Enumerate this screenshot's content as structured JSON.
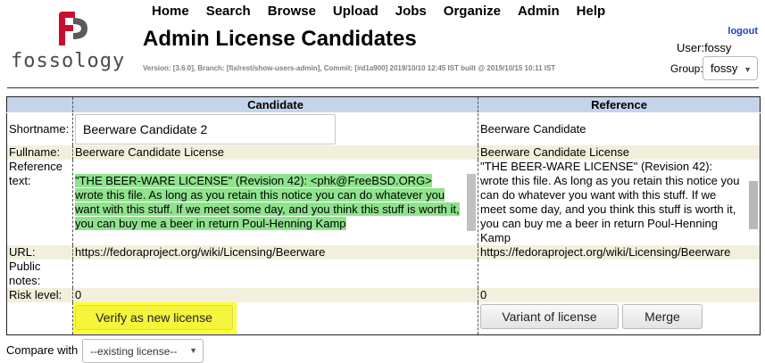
{
  "app": {
    "logo_text": "fossology",
    "brand_color": "#c8102e"
  },
  "nav": {
    "items": [
      {
        "label": "Home"
      },
      {
        "label": "Search"
      },
      {
        "label": "Browse"
      },
      {
        "label": "Upload"
      },
      {
        "label": "Jobs"
      },
      {
        "label": "Organize"
      },
      {
        "label": "Admin"
      },
      {
        "label": "Help"
      }
    ]
  },
  "page": {
    "title": "Admin License Candidates",
    "version": "Version: [3.6.0], Branch: [fix/rest/show-users-admin], Commit: [#d1a900] 2019/10/10 12:45 IST built @ 2019/10/15 10:11 IST"
  },
  "user": {
    "logout_label": "logout",
    "user_label": "User:",
    "user_name": "fossy",
    "group_label": "Group:",
    "group_value": "fossy"
  },
  "table": {
    "headers": {
      "candidate": "Candidate",
      "reference": "Reference"
    },
    "rows": {
      "shortname": {
        "label": "Shortname:",
        "candidate": "Beerware Candidate 2",
        "reference": "Beerware Candidate"
      },
      "fullname": {
        "label": "Fullname:",
        "candidate": "Beerware Candidate License",
        "reference": "Beerware Candidate License"
      },
      "reftext": {
        "label_line1": "Reference",
        "label_line2": "text:",
        "candidate": "\"THE BEER-WARE LICENSE\" (Revision 42): <phk@FreeBSD.ORG> wrote this file. As long as you retain this notice you can do whatever you want with this stuff. If we meet some day, and you think this stuff is worth it, you can buy me a beer in return Poul-Henning Kamp",
        "reference": "\"THE BEER-WARE LICENSE\" (Revision 42): wrote this file. As long as you retain this notice you can do whatever you want with this stuff. If we meet some day, and you think this stuff is worth it, you can buy me a beer in return Poul-Henning Kamp"
      },
      "url": {
        "label": "URL:",
        "candidate": "https://fedoraproject.org/wiki/Licensing/Beerware",
        "reference": "https://fedoraproject.org/wiki/Licensing/Beerware"
      },
      "public_notes": {
        "label_line1": "Public",
        "label_line2": "notes:",
        "candidate": "",
        "reference": ""
      },
      "risk": {
        "label": "Risk level:",
        "candidate": "0",
        "reference": "0"
      }
    },
    "buttons": {
      "verify": "Verify as new license",
      "variant": "Variant of license",
      "merge": "Merge"
    }
  },
  "compare": {
    "label": "Compare with",
    "value": "--existing license--"
  },
  "colors": {
    "header_bg": "#c4d4ea",
    "row_alt_bg": "#f2f0dc",
    "diff_highlight": "#8fe38d",
    "verify_highlight": "#ffff33",
    "link": "#1a3fcc"
  }
}
